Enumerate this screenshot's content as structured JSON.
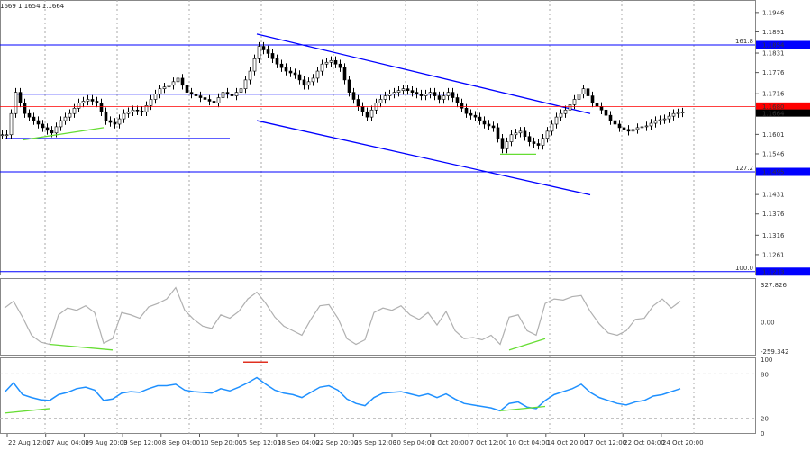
{
  "header": {
    "ohlc_text": "1669 1.1654 1.1664"
  },
  "colors": {
    "bull": "#ffffff",
    "bear": "#000000",
    "level": "#0000ff",
    "channel": "#0000ff",
    "divergence": "#66dd33",
    "cci": "#b0b0b0",
    "rsi": "#1e90ff",
    "bid": "#ff0000",
    "ask": "#000000"
  },
  "chart_data": {
    "type": "candlestick",
    "price_axis": {
      "range": [
        1.119,
        1.198
      ],
      "ticks": [
        "1.1946",
        "1.1891",
        "1.1831",
        "1.1776",
        "1.1716",
        "1.1601",
        "1.1546",
        "1.1431",
        "1.1376",
        "1.1316",
        "1.1261"
      ]
    },
    "close": [
      1.16,
      1.172,
      1.166,
      1.164,
      1.162,
      1.1605,
      1.164,
      1.166,
      1.169,
      1.17,
      1.169,
      1.164,
      1.163,
      1.166,
      1.167,
      1.1665,
      1.17,
      1.173,
      1.174,
      1.176,
      1.172,
      1.171,
      1.17,
      1.169,
      1.172,
      1.171,
      1.173,
      1.178,
      1.185,
      1.183,
      1.18,
      1.178,
      1.177,
      1.174,
      1.176,
      1.18,
      1.181,
      1.179,
      1.172,
      1.168,
      1.165,
      1.169,
      1.171,
      1.172,
      1.173,
      1.172,
      1.171,
      1.172,
      1.17,
      1.172,
      1.169,
      1.166,
      1.165,
      1.163,
      1.162,
      1.156,
      1.16,
      1.161,
      1.158,
      1.157,
      1.161,
      1.165,
      1.167,
      1.17,
      1.173,
      1.169,
      1.167,
      1.164,
      1.162,
      1.161,
      1.162,
      1.1625,
      1.164,
      1.1645,
      1.166,
      1.1664
    ],
    "levels": [
      {
        "label": "161.8",
        "price": "1.1854",
        "value": 1.1854
      },
      {
        "label": "127.2",
        "price": "1.1495",
        "value": 1.1495
      },
      {
        "label": "100.0",
        "price": "1.1213",
        "value": 1.1213
      }
    ],
    "bid_price": "1.1680",
    "bid": 1.168,
    "last_price": "1.1664",
    "last": 1.1664,
    "channel": {
      "upper": [
        [
          28,
          1.1885
        ],
        [
          65,
          1.166
        ]
      ],
      "lower": [
        [
          28,
          1.164
        ],
        [
          65,
          1.143
        ]
      ]
    },
    "ranges": [
      {
        "from": 1,
        "to": 50,
        "value": 1.1715
      },
      {
        "from": 0,
        "to": 25,
        "value": 1.1589
      }
    ],
    "x_labels": [
      "22 Aug 12:00",
      "27 Aug 04:00",
      "29 Aug 20:00",
      "3 Sep 12:00",
      "8 Sep 04:00",
      "10 Sep 20:00",
      "15 Sep 12:00",
      "18 Sep 04:00",
      "22 Sep 20:00",
      "25 Sep 12:00",
      "30 Sep 04:00",
      "2 Oct 20:00",
      "7 Oct 12:00",
      "10 Oct 04:00",
      "14 Oct 20:00",
      "17 Oct 12:00",
      "22 Oct 04:00",
      "24 Oct 20:00"
    ],
    "cci": {
      "range": [
        -259.342,
        327.826
      ],
      "ticks": [
        "327.826",
        "0.00",
        "-259.342"
      ],
      "values": [
        120,
        180,
        40,
        -120,
        -180,
        -200,
        60,
        120,
        100,
        140,
        80,
        -190,
        -150,
        80,
        60,
        30,
        130,
        160,
        200,
        300,
        100,
        20,
        -40,
        -60,
        60,
        30,
        90,
        200,
        260,
        160,
        40,
        -40,
        -80,
        -120,
        20,
        140,
        150,
        30,
        -150,
        -200,
        -160,
        80,
        120,
        100,
        140,
        60,
        20,
        80,
        -30,
        90,
        -80,
        -150,
        -140,
        -160,
        -120,
        -200,
        40,
        60,
        -80,
        -120,
        160,
        200,
        190,
        220,
        230,
        90,
        -20,
        -100,
        -120,
        -80,
        20,
        30,
        140,
        200,
        120,
        180
      ]
    },
    "rsi": {
      "range": [
        0,
        100
      ],
      "ticks": [
        "100",
        "80",
        "20",
        "0"
      ],
      "values": [
        55,
        68,
        52,
        48,
        45,
        44,
        52,
        55,
        60,
        62,
        58,
        44,
        46,
        54,
        56,
        55,
        60,
        64,
        64,
        66,
        58,
        56,
        55,
        54,
        60,
        57,
        62,
        68,
        75,
        66,
        58,
        54,
        52,
        48,
        55,
        62,
        64,
        58,
        46,
        40,
        37,
        48,
        54,
        55,
        56,
        53,
        50,
        53,
        48,
        53,
        46,
        40,
        38,
        36,
        34,
        30,
        40,
        42,
        35,
        33,
        44,
        52,
        56,
        60,
        66,
        55,
        48,
        44,
        40,
        38,
        42,
        44,
        50,
        52,
        56,
        60
      ]
    },
    "rsi_marker": {
      "from": 27,
      "to": 29,
      "value": 96
    }
  }
}
